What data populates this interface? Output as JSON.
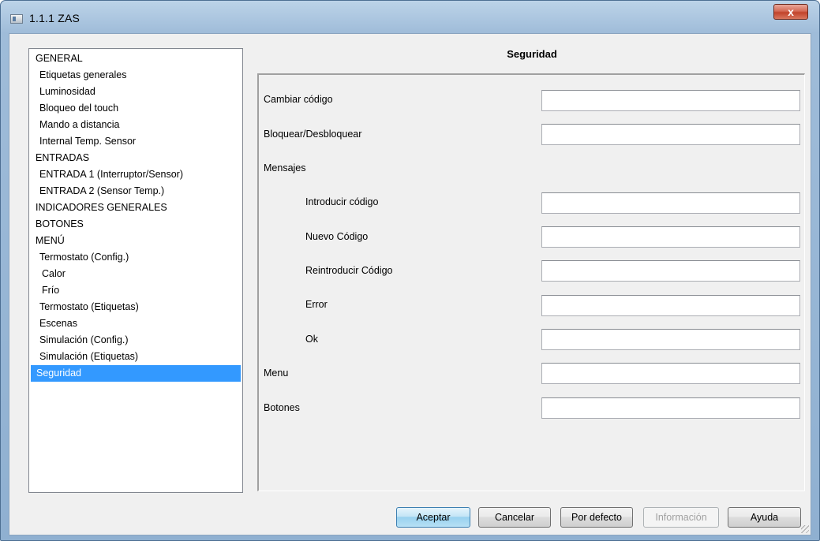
{
  "window": {
    "title": "1.1.1 ZAS",
    "close_glyph": "x"
  },
  "tree": {
    "items": [
      {
        "label": "GENERAL",
        "level": 0
      },
      {
        "label": "Etiquetas generales",
        "level": 1
      },
      {
        "label": "Luminosidad",
        "level": 1
      },
      {
        "label": "Bloqueo del touch",
        "level": 1
      },
      {
        "label": "Mando a distancia",
        "level": 1
      },
      {
        "label": "Internal Temp. Sensor",
        "level": 1
      },
      {
        "label": "ENTRADAS",
        "level": 0
      },
      {
        "label": "ENTRADA 1 (Interruptor/Sensor)",
        "level": 1
      },
      {
        "label": "ENTRADA 2 (Sensor Temp.)",
        "level": 1
      },
      {
        "label": "INDICADORES GENERALES",
        "level": 0
      },
      {
        "label": "BOTONES",
        "level": 0
      },
      {
        "label": "MENÚ",
        "level": 0
      },
      {
        "label": "Termostato (Config.)",
        "level": 1
      },
      {
        "label": "Calor",
        "level": 2
      },
      {
        "label": "Frío",
        "level": 2
      },
      {
        "label": "Termostato (Etiquetas)",
        "level": 1
      },
      {
        "label": "Escenas",
        "level": 1
      },
      {
        "label": "Simulación (Config.)",
        "level": 1
      },
      {
        "label": "Simulación (Etiquetas)",
        "level": 1
      },
      {
        "label": "Seguridad",
        "level": 1,
        "selected": true
      }
    ]
  },
  "section": {
    "heading": "Seguridad",
    "rows": {
      "cambiar_codigo": {
        "label": "Cambiar código",
        "value": ""
      },
      "bloquear": {
        "label": "Bloquear/Desbloquear",
        "value": ""
      },
      "mensajes": {
        "label": "Mensajes"
      },
      "introducir": {
        "label": "Introducir código",
        "value": ""
      },
      "nuevo": {
        "label": "Nuevo Código",
        "value": ""
      },
      "reintroducir": {
        "label": "Reintroducir Código",
        "value": ""
      },
      "error": {
        "label": "Error",
        "value": ""
      },
      "ok": {
        "label": "Ok",
        "value": ""
      },
      "menu": {
        "label": "Menu",
        "value": ""
      },
      "botones": {
        "label": "Botones",
        "value": ""
      }
    }
  },
  "buttons": {
    "accept": "Aceptar",
    "cancel": "Cancelar",
    "defaults": "Por defecto",
    "info": "Información",
    "help": "Ayuda"
  },
  "colors": {
    "selection": "#3399ff",
    "window_frame": "#9fbcd9",
    "close_button": "#c1432b"
  }
}
